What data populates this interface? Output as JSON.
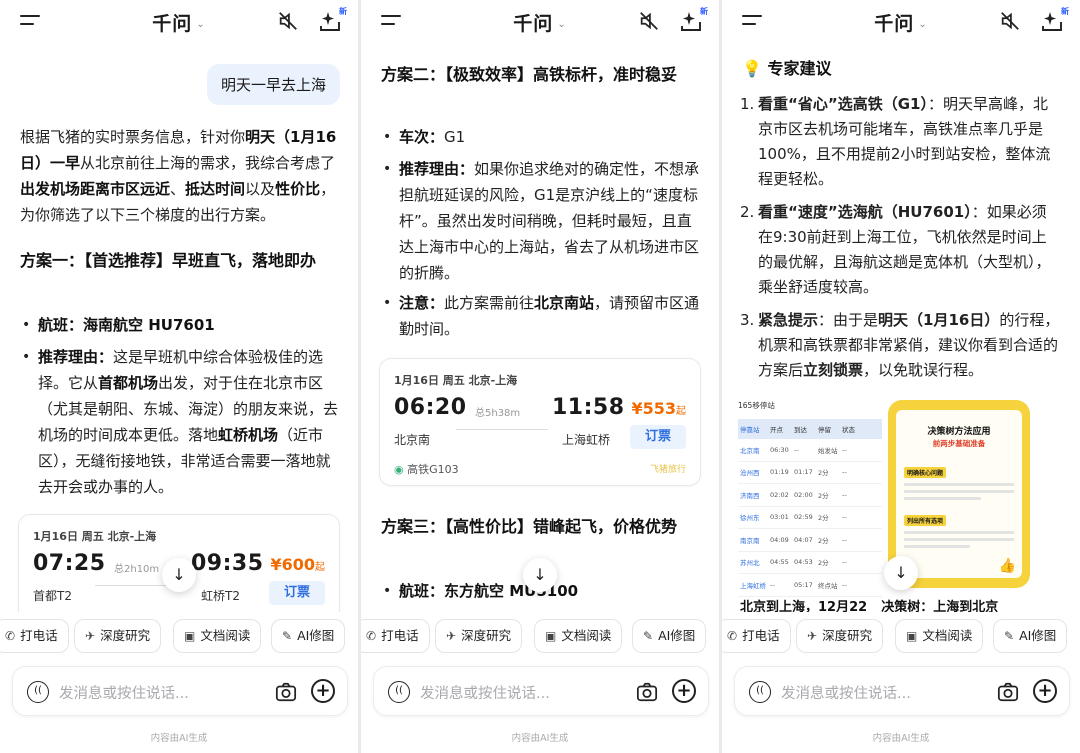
{
  "app": {
    "title": "千问",
    "new_badge": "新"
  },
  "user_query": "明天一早去上海",
  "intro": {
    "a": "根据飞猪的实时票务信息，针对你",
    "b": "明天（1月16日）一早",
    "c": "从北京前往上海的需求，我综合考虑了",
    "d": "出发机场距离市区远近",
    "e": "、",
    "f": "抵达时间",
    "g": "以及",
    "h": "性价比",
    "i": "，为你筛选了以下三个梯度的出行方案。"
  },
  "plan1": {
    "title": "方案一：【首选推荐】早班直飞，落地即办",
    "flight_label": "航班：",
    "flight_value": "海南航空 HU7601",
    "reason_label": "推荐理由：",
    "reason_a": "这是早班机中综合体验极佳的选择。它从",
    "reason_b": "首都机场",
    "reason_c": "出发，对于住在北京市区（尤其是朝阳、东城、海淀）的朋友来说，去机场的时间成本更低。落地",
    "reason_d": "虹桥机场",
    "reason_e": "（近市区），无缝衔接地铁，非常适合需要一落地就去开会或办事的人。",
    "card": {
      "header": "1月16日 周五 北京-上海",
      "dep_time": "07:25",
      "arr_time": "09:35",
      "duration": "总2h10m",
      "dep_place": "首都T2",
      "arr_place": "虹桥T2",
      "price": "¥600",
      "price_suffix": "起",
      "buy": "订票"
    }
  },
  "plan2": {
    "title": "方案二：【极致效率】高铁标杆，准时稳妥",
    "train_label": "车次：",
    "train_value": "G1",
    "reason_label": "推荐理由：",
    "reason_text": "如果你追求绝对的确定性，不想承担航班延误的风险，G1是京沪线上的“速度标杆”。虽然出发时间稍晚，但耗时最短，且直达上海市中心的上海站，省去了从机场进市区的折腾。",
    "note_label": "注意：",
    "note_a": "此方案需前往",
    "note_b": "北京南站",
    "note_c": "，请预留市区通勤时间。",
    "card": {
      "header": "1月16日 周五 北京-上海",
      "dep_time": "06:20",
      "arr_time": "11:58",
      "duration": "总5h38m",
      "dep_place": "北京南",
      "arr_place": "上海虹桥",
      "price": "¥553",
      "price_suffix": "起",
      "buy": "订票",
      "train_tag": "高铁G103",
      "watermark": "飞猪旅行"
    }
  },
  "plan3": {
    "title": "方案三：【高性价比】错峰起飞，价格优势",
    "flight_label": "航班：",
    "flight_value": "东方航空 MU5100"
  },
  "advice": {
    "title": "专家建议",
    "items": [
      {
        "n": "1.",
        "bold": "看重“省心”选高铁（G1）",
        "text": "：明天早高峰，北京市区去机场可能堵车，高铁准点率几乎是100%，且不用提前2小时到站安检，整体流程更轻松。"
      },
      {
        "n": "2.",
        "bold": "看重“速度”选海航（HU7601）",
        "text": "：如果必须在9:30前赶到上海工位，飞机依然是时间上的最优解，且海航这趟是宽体机（大型机），乘坐舒适度较高。"
      },
      {
        "n": "3.",
        "bold": "紧急提示",
        "text_a": "：由于是",
        "bold2": "明天（1月16日）",
        "text_b": "的行程，机票和高铁票都非常紧俏，建议你看到合适的方案后",
        "bold3": "立刻锁票",
        "text_c": "，以免耽误行程。"
      }
    ],
    "timetable": {
      "title": "165移停站",
      "head": [
        "停靠站",
        "开点",
        "到达",
        "停留",
        "状态"
      ],
      "rows": [
        [
          "北京南",
          "06:30",
          "--",
          "始发站",
          "--"
        ],
        [
          "沧州西",
          "01:19",
          "01:17",
          "2分",
          "--"
        ],
        [
          "济南西",
          "02:02",
          "02:00",
          "2分",
          "--"
        ],
        [
          "徐州东",
          "03:01",
          "02:59",
          "2分",
          "--"
        ],
        [
          "南京南",
          "04:09",
          "04:07",
          "2分",
          "--"
        ],
        [
          "苏州北",
          "04:55",
          "04:53",
          "2分",
          "--"
        ],
        [
          "上海虹桥",
          "--",
          "05:17",
          "终点站",
          "--"
        ]
      ]
    },
    "poster": {
      "title": "决策树方法应用",
      "subtitle": "前两步基础准备",
      "tag1": "明确核心问题",
      "tag2": "列出所有选项"
    },
    "caption_left": "北京到上海，12月22",
    "caption_right": "决策树：上海到北京"
  },
  "quick_actions": [
    {
      "icon": "phone-icon",
      "label": "打电话"
    },
    {
      "icon": "research-icon",
      "label": "深度研究"
    },
    {
      "icon": "doc-icon",
      "label": "文档阅读"
    },
    {
      "icon": "image-edit-icon",
      "label": "AI修图"
    }
  ],
  "input": {
    "placeholder": "发消息或按住说话..."
  },
  "footer": "内容由AI生成"
}
